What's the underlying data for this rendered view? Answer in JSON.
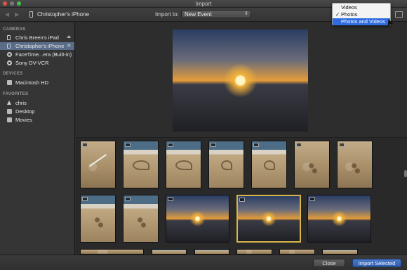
{
  "window": {
    "title": "Import"
  },
  "toolbar": {
    "device_name": "Christopher's iPhone",
    "import_to_label": "Import to:",
    "event_value": "New Event"
  },
  "filter_menu": {
    "items": [
      {
        "label": "Videos",
        "checked": false,
        "highlighted": false
      },
      {
        "label": "Photos",
        "checked": true,
        "highlighted": false
      },
      {
        "label": "Photos and Videos",
        "checked": false,
        "highlighted": true
      }
    ],
    "check_glyph": "✓"
  },
  "sidebar": {
    "sections": [
      {
        "label": "CAMERAS"
      },
      {
        "label": "DEVICES"
      },
      {
        "label": "FAVORITES"
      }
    ],
    "cameras": [
      {
        "label": "Chris Breen's iPad",
        "icon": "tablet-icon",
        "eject": true
      },
      {
        "label": "Christopher's iPhone",
        "icon": "phone-icon",
        "eject": true,
        "selected": true
      },
      {
        "label": "FaceTime...era (Built-in)",
        "icon": "camera-icon"
      },
      {
        "label": "Sony DV-VCR",
        "icon": "camera-icon"
      }
    ],
    "devices": [
      {
        "label": "Macintosh HD",
        "icon": "disk-icon"
      }
    ],
    "favorites": [
      {
        "label": "chris",
        "icon": "home-icon"
      },
      {
        "label": "Desktop",
        "icon": "folder-icon"
      },
      {
        "label": "Movies",
        "icon": "folder-icon"
      }
    ]
  },
  "buttons": {
    "close": "Close",
    "import_selected": "Import Selected"
  },
  "colors": {
    "selection": "#5a6d88",
    "accent": "#2f6ce0",
    "thumb_selected_border": "#d9b64a"
  }
}
